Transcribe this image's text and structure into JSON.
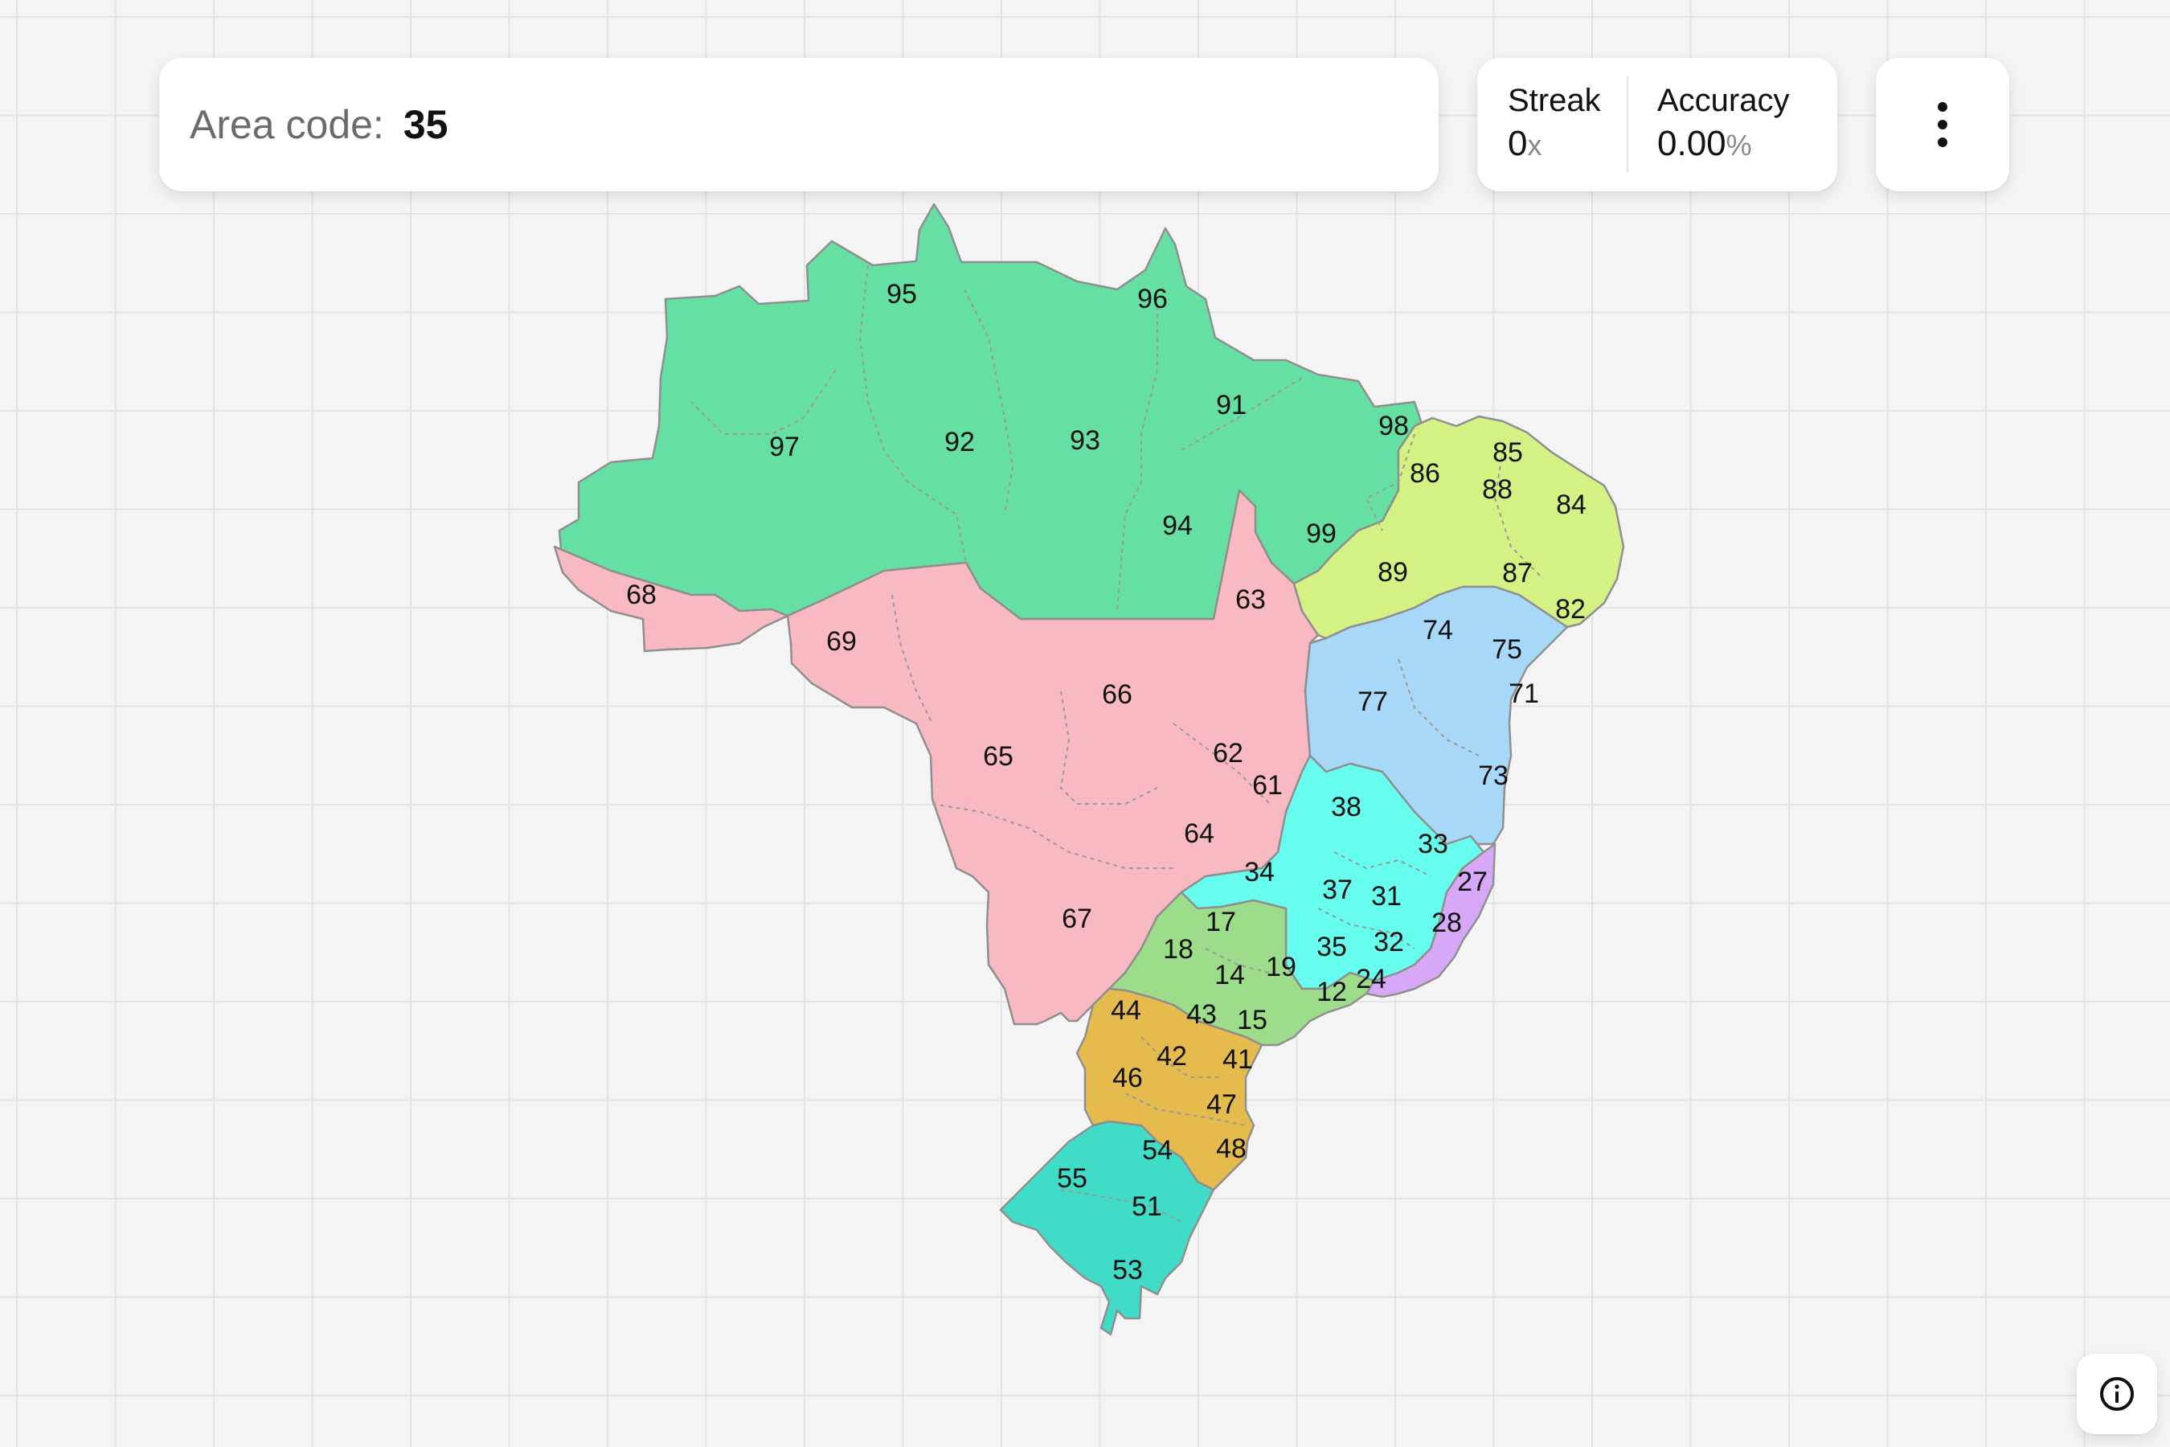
{
  "prompt": {
    "label": "Area code:",
    "value": "35"
  },
  "stats": {
    "streak": {
      "label": "Streak",
      "value": "0",
      "unit": "x"
    },
    "accuracy": {
      "label": "Accuracy",
      "value": "0.00",
      "unit": "%"
    }
  },
  "menu": {
    "icon": "vertical-dots-icon"
  },
  "info": {
    "icon": "info-icon"
  },
  "region_colors": {
    "north": "#66dfa2",
    "northeast_top": "#d4f284",
    "bahia": "#a8d8f8",
    "center_west": "#f8b9c2",
    "minas_gerais": "#66fcee",
    "espirito_santo": "#d8a8f8",
    "sao_paulo": "#9ddc8a",
    "parana": "#e4bb4c",
    "south": "#40dcc8"
  },
  "area_codes": [
    {
      "code": "95"
    },
    {
      "code": "96"
    },
    {
      "code": "97"
    },
    {
      "code": "92"
    },
    {
      "code": "93"
    },
    {
      "code": "91"
    },
    {
      "code": "98"
    },
    {
      "code": "94"
    },
    {
      "code": "99"
    },
    {
      "code": "85"
    },
    {
      "code": "86"
    },
    {
      "code": "88"
    },
    {
      "code": "84"
    },
    {
      "code": "89"
    },
    {
      "code": "87"
    },
    {
      "code": "82"
    },
    {
      "code": "68"
    },
    {
      "code": "69"
    },
    {
      "code": "63"
    },
    {
      "code": "74"
    },
    {
      "code": "75"
    },
    {
      "code": "66"
    },
    {
      "code": "77"
    },
    {
      "code": "71"
    },
    {
      "code": "65"
    },
    {
      "code": "62"
    },
    {
      "code": "61"
    },
    {
      "code": "73"
    },
    {
      "code": "38"
    },
    {
      "code": "64"
    },
    {
      "code": "33"
    },
    {
      "code": "34"
    },
    {
      "code": "27"
    },
    {
      "code": "37"
    },
    {
      "code": "31"
    },
    {
      "code": "67"
    },
    {
      "code": "17"
    },
    {
      "code": "28"
    },
    {
      "code": "18"
    },
    {
      "code": "35"
    },
    {
      "code": "32"
    },
    {
      "code": "19"
    },
    {
      "code": "14"
    },
    {
      "code": "24"
    },
    {
      "code": "12"
    },
    {
      "code": "44"
    },
    {
      "code": "43"
    },
    {
      "code": "15"
    },
    {
      "code": "42"
    },
    {
      "code": "41"
    },
    {
      "code": "46"
    },
    {
      "code": "47"
    },
    {
      "code": "54"
    },
    {
      "code": "48"
    },
    {
      "code": "55"
    },
    {
      "code": "51"
    },
    {
      "code": "53"
    }
  ]
}
